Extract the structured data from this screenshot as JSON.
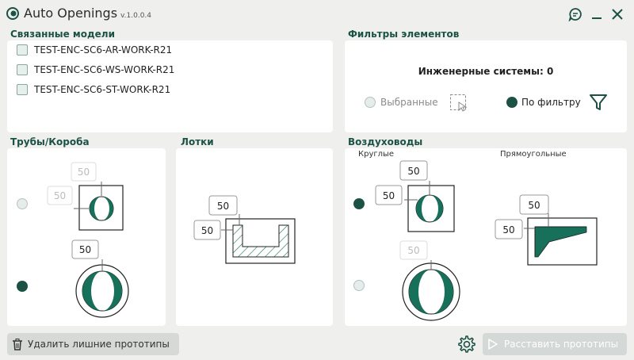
{
  "app": {
    "title": "Auto Openings",
    "version": "v.1.0.0.4"
  },
  "sections": {
    "linked_models": "Связанные модели",
    "element_filters": "Фильтры элементов",
    "pipes": "Трубы/Короба",
    "trays": "Лотки",
    "ducts": "Воздуховоды"
  },
  "models": [
    {
      "label": "TEST-ENC-SC6-AR-WORK-R21",
      "checked": false
    },
    {
      "label": "TEST-ENC-SC6-WS-WORK-R21",
      "checked": false
    },
    {
      "label": "TEST-ENC-SC6-ST-WORK-R21",
      "checked": false
    }
  ],
  "filters": {
    "systems_label": "Инженерные системы: 0",
    "selected_label": "Выбранные",
    "by_filter_label": "По фильтру",
    "mode": "by_filter"
  },
  "pipes": {
    "offset_a1": "50",
    "offset_a2": "50",
    "offset_b1": "50",
    "selected": "b"
  },
  "trays": {
    "offset_1": "50",
    "offset_2": "50"
  },
  "ducts": {
    "round_label": "Круглые",
    "rect_label": "Прямоугольные",
    "round_offset_1": "50",
    "round_offset_2": "50",
    "round_offset_3": "50",
    "rect_offset_1": "50",
    "rect_offset_2": "50",
    "selected": "round_a"
  },
  "footer": {
    "delete_label": "Удалить лишние прототипы",
    "place_label": "Расставить прототипы"
  },
  "colors": {
    "accent": "#1c5245",
    "fill": "#17705a",
    "background": "#eff0ee"
  }
}
